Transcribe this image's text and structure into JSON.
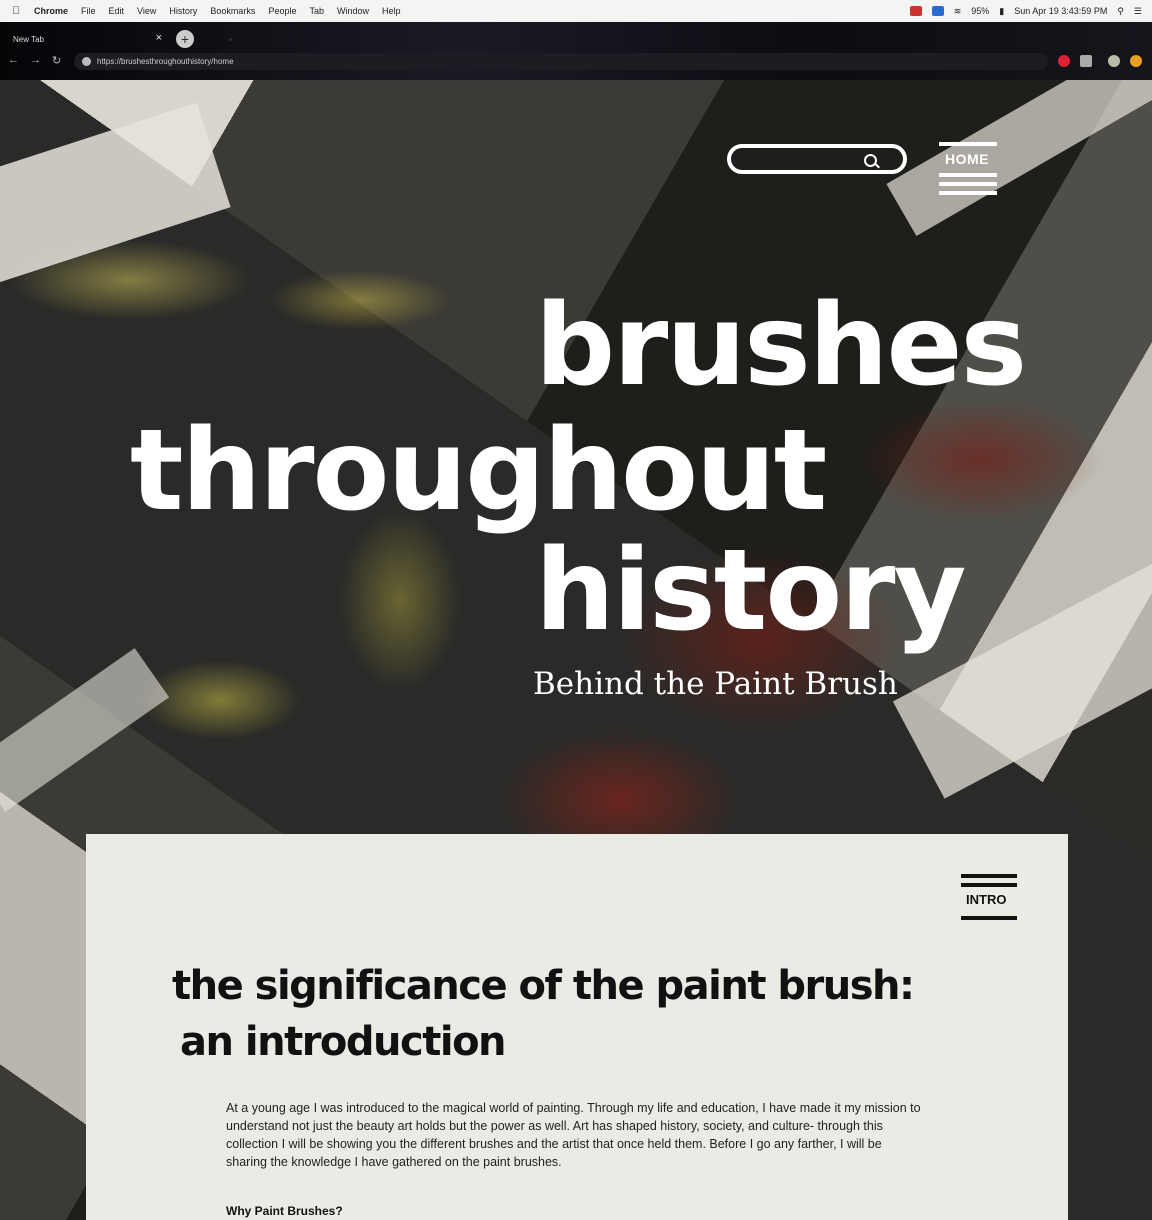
{
  "menubar": {
    "app": "Chrome",
    "items": [
      "File",
      "Edit",
      "View",
      "History",
      "Bookmarks",
      "People",
      "Tab",
      "Window",
      "Help"
    ],
    "battery": "95%",
    "clock": "Sun Apr 19  3:43:59 PM"
  },
  "browser": {
    "tab_title": "New Tab",
    "url": "https://brushesthroughouthistory/home"
  },
  "nav": {
    "home_label": "HOME",
    "search_placeholder": ""
  },
  "hero": {
    "title_line1": "brushes",
    "title_line2": "throughout",
    "title_line3": "history",
    "subtitle": "Behind the Paint Brush"
  },
  "intro": {
    "section_label": "INTRO",
    "heading_line1": "the significance of the paint brush:",
    "heading_line2": "an introduction",
    "body": "At a young age I was introduced to the magical world of painting. Through my life and education, I have made it my mission to understand not just the beauty art holds but the power as well. Art has shaped history, society, and culture- through this collection I will be showing you the different brushes and the artist that once held them. Before I go any farther, I will be sharing the  knowledge I have gathered on the paint brushes.",
    "subheading": "Why Paint Brushes?"
  },
  "colors": {
    "card_bg": "#ebebe6",
    "text_light": "#ffffff",
    "text_dark": "#111111"
  }
}
